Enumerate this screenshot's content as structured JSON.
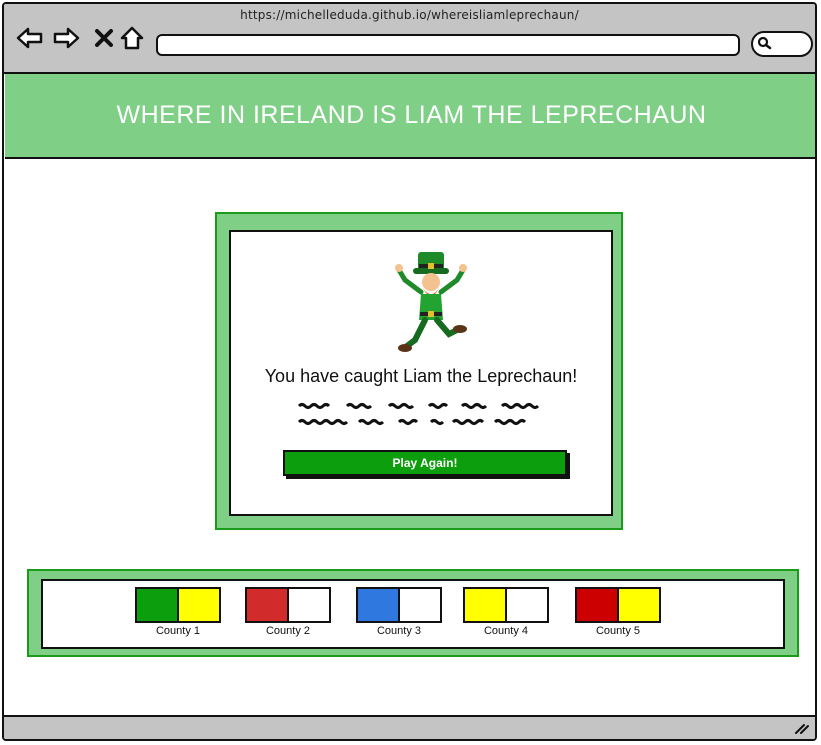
{
  "browser": {
    "url": "https://michelleduda.github.io/whereisliamleprechaun/"
  },
  "icons": {
    "back": "back-arrow-icon",
    "forward": "forward-arrow-icon",
    "close": "close-icon",
    "home": "home-icon",
    "search": "search-icon",
    "resize": "resize-grip-icon"
  },
  "header": {
    "title": "WHERE IN IRELAND IS LIAM THE LEPRECHAUN"
  },
  "modal": {
    "message": "You have caught Liam the Leprechaun!",
    "button_label": "Play Again!"
  },
  "legend": {
    "counties": [
      {
        "label": "County 1",
        "colors": [
          "#0d9e0d",
          "#ffff00"
        ]
      },
      {
        "label": "County 2",
        "colors": [
          "#d22b2b",
          "#ffffff"
        ]
      },
      {
        "label": "County 3",
        "colors": [
          "#2f78e0",
          "#ffffff"
        ]
      },
      {
        "label": "County 4",
        "colors": [
          "#ffff00",
          "#ffffff"
        ]
      },
      {
        "label": "County 5",
        "colors": [
          "#cc0000",
          "#ffff00"
        ]
      }
    ]
  },
  "colors": {
    "header_green": "#80cf87",
    "button_green": "#0d9e0d",
    "border_green": "#1a9b1a",
    "chrome_gray": "#c4c4c4"
  }
}
